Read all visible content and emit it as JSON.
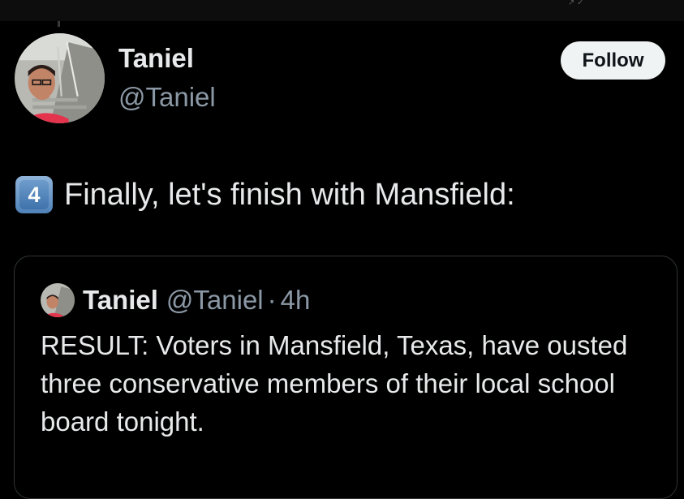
{
  "author": {
    "name": "Taniel",
    "handle": "@Taniel",
    "avatar_icon": "profile-photo"
  },
  "follow_button": {
    "label": "Follow"
  },
  "tweet": {
    "number_badge": "4",
    "text": "Finally, let's finish with Mansfield:"
  },
  "quoted_tweet": {
    "author_name": "Taniel",
    "author_handle": "@Taniel",
    "separator": "·",
    "time": "4h",
    "body": "RESULT: Voters in Mansfield, Texas, have ousted three conservative members of their local school board tonight."
  },
  "colors": {
    "background": "#000000",
    "primary_text": "#e7e9ea",
    "secondary_text": "#8b98a5",
    "follow_bg": "#eff3f4",
    "border": "#2f3336"
  }
}
